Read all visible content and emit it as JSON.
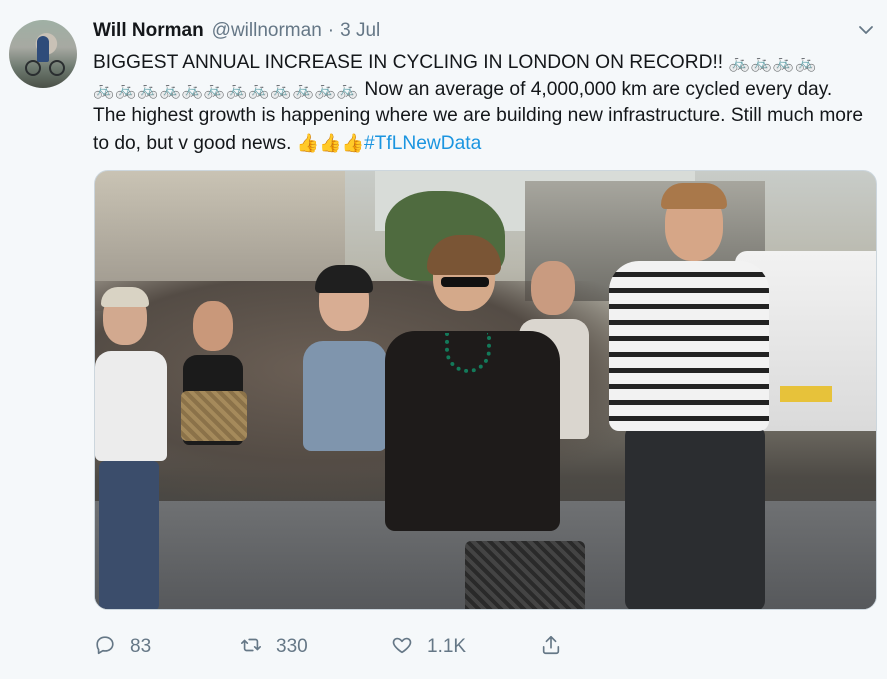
{
  "author": {
    "name": "Will Norman",
    "handle": "@willnorman",
    "separator": "·",
    "date": "3 Jul"
  },
  "tweet": {
    "line1_text": "BIGGEST ANNUAL INCREASE IN CYCLING IN LONDON ON RECORD!!",
    "line1_bikes": "🚲🚲🚲🚲",
    "line2_bikes": "🚲🚲🚲🚲🚲🚲🚲🚲🚲🚲🚲🚲",
    "line2_text": "Now an average of 4,000,000 km are cycled every day. The highest growth is happening where we are building new infrastructure. Still much more to do, but v good news.",
    "thumbs": "👍👍👍",
    "hashtag": "#TfLNewData"
  },
  "media": {
    "alt": "photo"
  },
  "actions": {
    "replies": "83",
    "retweets": "330",
    "likes": "1.1K"
  },
  "icons": {
    "menu": "chevron-down-icon",
    "reply": "reply-icon",
    "retweet": "retweet-icon",
    "like": "heart-icon",
    "share": "share-icon"
  },
  "colors": {
    "text": "#14171a",
    "muted": "#657786",
    "link": "#1b95e0",
    "background": "#f5f8fa",
    "bike_emoji": "#e0245e"
  }
}
